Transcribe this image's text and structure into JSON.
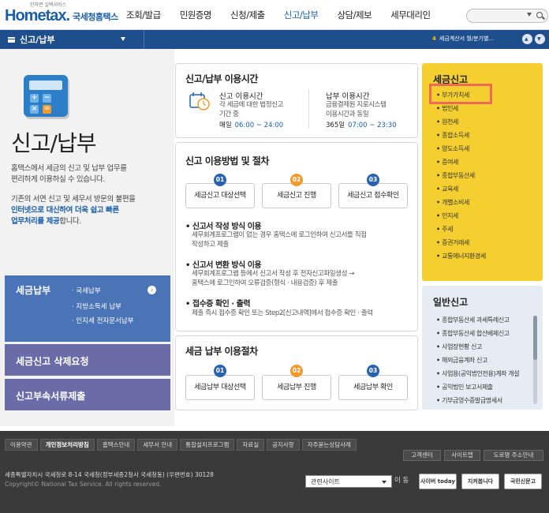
{
  "header": {
    "logo_main": "Hometax.",
    "logo_sub": "국세청홈택스",
    "logo_tagline": "안하면 실택서비스",
    "nav": [
      "조회/발급",
      "민원증명",
      "신청/제출",
      "신고/납부",
      "상담/제보",
      "세무대리인"
    ]
  },
  "subbar": {
    "menu_label": "신고/납부",
    "notice_num": "4",
    "notice_text": "세금계산서 월/분기별..."
  },
  "hero": {
    "title": "신고/납부",
    "p1_l1": "홈택스에서 세금의 신고 및 납부 업무를",
    "p1_l2": "편리하게 이용하실 수 있습니다.",
    "p2_l1": "기존의 서면 신고 및 세무서 방문의 불편을",
    "p2_l2_blue": "인터넷으로 대신하여 더욱 쉽고 빠른",
    "p2_l3_blue": "업무처리를 제공",
    "p2_l3_end": "합니다."
  },
  "calc": {
    "keys": [
      "+",
      "−",
      "×",
      "="
    ]
  },
  "left_menu": {
    "pay_title": "세금납부",
    "pay_items": [
      "· 국세납부",
      "· 지방소득세 납부",
      "· 인지세 전자문서납부"
    ],
    "pay_chev": "›",
    "delete_req": "세금신고 삭제요청",
    "attach": "신고부속서류제출"
  },
  "hours": {
    "title": "신고/납부 이용시간",
    "report_title": "신고 이용시간",
    "report_desc1": "각 세금에 대한 법정신고",
    "report_desc2": "기간 중",
    "report_day": "매일",
    "report_time": "06:00 ~ 24:00",
    "pay_title": "납부 이용시간",
    "pay_desc1": "금융결제원 지로시스템",
    "pay_desc2": "이용시간과 동일",
    "pay_day": "365일",
    "pay_time": "07:00 ~ 23:30"
  },
  "method": {
    "title": "신고 이용방법 및 절차",
    "steps": [
      {
        "n": "01",
        "label": "세금신고 대상선택"
      },
      {
        "n": "02",
        "label": "세금신고 진행"
      },
      {
        "n": "03",
        "label": "세금신고 접수확인"
      }
    ],
    "b1_title": "신고서 작성 방식 이용",
    "b1_d1": "세무회계프로그램이 없는 경우 홈택스에 로그인하여 신고서를 직접",
    "b1_d2": "작성하고 제출",
    "b2_title": "신고서 변환 방식 이용",
    "b2_d1": "세무회계프로그램 등에서 신고서 작성 후 전자신고파일생성 →",
    "b2_d2": "홈택스에 로그인하여 오류검증(형식 · 내용검증) 후 제출",
    "b3_title": "접수증 확인 · 출력",
    "b3_d1": "제출 즉시 접수증 확인 또는 Step2[신고내역]에서 접수증 확인 · 출력"
  },
  "payproc": {
    "title": "세금 납부 이용절차",
    "steps": [
      {
        "n": "01",
        "label": "세금납부 대상선택"
      },
      {
        "n": "02",
        "label": "세금납부 진행"
      },
      {
        "n": "03",
        "label": "세금납부 확인"
      }
    ]
  },
  "tax_report": {
    "title": "세금신고",
    "items": [
      "부가가치세",
      "법인세",
      "원천세",
      "종합소득세",
      "양도소득세",
      "증여세",
      "종합부동산세",
      "교육세",
      "개별소비세",
      "인지세",
      "주세",
      "증권거래세",
      "교통에너지환경세"
    ]
  },
  "general_report": {
    "title": "일반신고",
    "items": [
      "종합부동산세 과세특례신고",
      "종합부동산세 합산배제신고",
      "사업장현황 신고",
      "해외금융계좌 신고",
      "사업용(공익법인전용)계좌 개설",
      "공익법인 보고서제출",
      "기부금영수증발급명세서"
    ]
  },
  "footer": {
    "links": [
      "이용약관",
      "개인정보처리방침",
      "홈택스안내",
      "세무서 안내",
      "통합설치프로그램",
      "자료실",
      "공지사항",
      "자주묻는상담사례"
    ],
    "btns": [
      "고객센터",
      "사이트맵",
      "도로명 주소안내"
    ],
    "addr": "세종특별자치시 국세청로 8-14 국세청(정부세종2청사 국세청동) (우편번호) 30128",
    "copy": "Copyright© National Tax Service. All rights reserved.",
    "related": "관련사이트",
    "go": "이 동",
    "banners": [
      "사이버 today",
      "지켜봅니다",
      "국민신문고"
    ]
  },
  "colors": {
    "brand": "#1b5fa8",
    "accent_orange": "#f29a2e",
    "highlight": "#ee6a55",
    "yellow_panel": "#f4cf2f"
  }
}
